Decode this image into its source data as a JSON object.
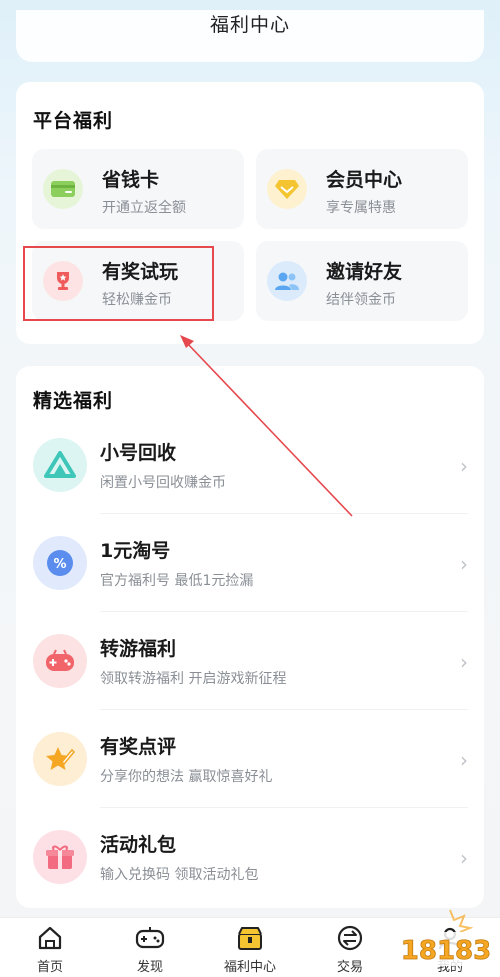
{
  "header": {
    "title": "福利中心"
  },
  "platform": {
    "title": "平台福利",
    "tiles": [
      {
        "title": "省钱卡",
        "subtitle": "开通立返全额",
        "icon": "wallet-card-icon",
        "color": "#8ccf5c"
      },
      {
        "title": "会员中心",
        "subtitle": "享专属特惠",
        "icon": "diamond-icon",
        "color": "#f5c531"
      },
      {
        "title": "有奖试玩",
        "subtitle": "轻松赚金币",
        "icon": "trophy-icon",
        "color": "#ef5b5b"
      },
      {
        "title": "邀请好友",
        "subtitle": "结伴领金币",
        "icon": "friends-icon",
        "color": "#5aa6f0"
      }
    ]
  },
  "featured": {
    "title": "精选福利",
    "items": [
      {
        "title": "小号回收",
        "subtitle": "闲置小号回收赚金币",
        "icon": "recycle-icon",
        "color": "#3ec6b9"
      },
      {
        "title": "1元淘号",
        "subtitle": "官方福利号 最低1元捡漏",
        "icon": "percent-badge-icon",
        "color": "#5b8def"
      },
      {
        "title": "转游福利",
        "subtitle": "领取转游福利 开启游戏新征程",
        "icon": "gamepad-icon",
        "color": "#f0646a"
      },
      {
        "title": "有奖点评",
        "subtitle": "分享你的想法 赢取惊喜好礼",
        "icon": "pen-star-icon",
        "color": "#f5a623"
      },
      {
        "title": "活动礼包",
        "subtitle": "输入兑换码 领取活动礼包",
        "icon": "gift-icon",
        "color": "#f26b80"
      }
    ]
  },
  "tabbar": {
    "tabs": [
      {
        "label": "首页",
        "icon": "home-icon"
      },
      {
        "label": "发现",
        "icon": "game-controller-icon"
      },
      {
        "label": "福利中心",
        "icon": "treasure-box-icon"
      },
      {
        "label": "交易",
        "icon": "exchange-icon"
      },
      {
        "label": "我的",
        "icon": "user-icon"
      }
    ]
  },
  "watermark": {
    "text": "18183"
  },
  "colors": {
    "highlight": "#e5484d",
    "accent": "#f5c531"
  }
}
